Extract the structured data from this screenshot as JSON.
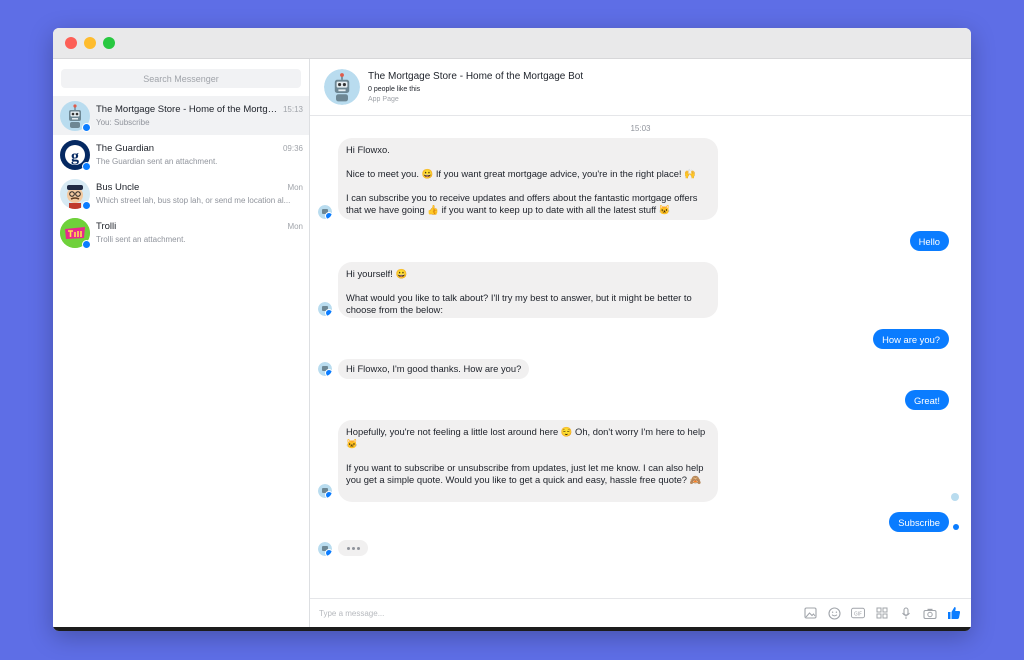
{
  "search": {
    "placeholder": "Search Messenger"
  },
  "conversations": [
    {
      "name": "The Mortgage Store - Home of the Mortgag...",
      "time": "15:13",
      "snippet": "You: Subscribe"
    },
    {
      "name": "The Guardian",
      "time": "09:36",
      "snippet": "The Guardian sent an attachment."
    },
    {
      "name": "Bus Uncle",
      "time": "Mon",
      "snippet": "Which street lah, bus stop lah, or send me location al..."
    },
    {
      "name": "Trolli",
      "time": "Mon",
      "snippet": "Trolli sent an attachment."
    }
  ],
  "header": {
    "title": "The Mortgage Store - Home of the Mortgage Bot",
    "likes": "0 people like this",
    "type": "App Page"
  },
  "timestamp": "15:03",
  "messages": {
    "m1": [
      "Hi Flowxo.",
      "Nice to meet you. 😀 If you want great mortgage advice, you're in the right place! 🙌",
      "I can subscribe you to receive updates and offers about the fantastic mortgage offers that we have going 👍 if you want to keep up to date with all the latest stuff 🐱"
    ],
    "m2": "Hello",
    "m3": [
      "Hi yourself! 😀",
      "What would you like to talk about? I'll try my best to answer, but it might be better to choose from the below:"
    ],
    "m4": "How are you?",
    "m5": "Hi Flowxo, I'm good thanks. How are you?",
    "m6": "Great!",
    "m7": [
      "Hopefully, you're not feeling a little lost around here 😌 Oh, don't worry I'm here to help 🐱",
      "If you want to subscribe or unsubscribe from updates, just let me know. I can also help you get a simple quote. Would you like to get a quick and easy, hassle free quote? 🙈"
    ],
    "m8": "Subscribe"
  },
  "composer": {
    "placeholder": "Type a message..."
  },
  "icons": [
    "photo-icon",
    "emoji-icon",
    "gif-icon",
    "sticker-icon",
    "microphone-icon",
    "camera-icon",
    "thumbs-up-icon"
  ],
  "colors": {
    "accent": "#0a7cff",
    "background": "#5e6ee6",
    "bubble_in": "#f1f0f0"
  }
}
